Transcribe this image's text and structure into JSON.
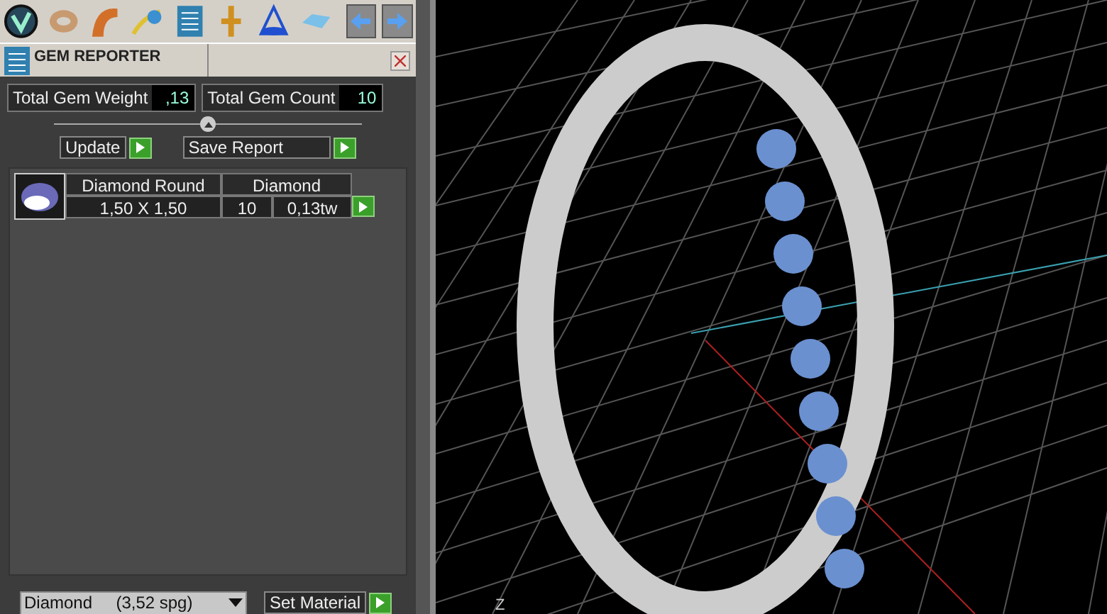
{
  "panel": {
    "title": "GEM REPORTER"
  },
  "totals": [
    {
      "label": "Total Gem Weight",
      "value": ",13"
    },
    {
      "label": "Total Gem Count",
      "value": "10"
    }
  ],
  "actions": [
    "Update",
    "Save Report"
  ],
  "gems": [
    {
      "name": "Diamond Round",
      "material": "Diamond",
      "size": "1,50 X 1,50",
      "count": "10",
      "weight": "0,13tw"
    }
  ],
  "material_select": {
    "value": "Diamond     (3,52 spg)"
  },
  "set_material": "Set Material",
  "viewport": {
    "axis_label": "Z"
  }
}
